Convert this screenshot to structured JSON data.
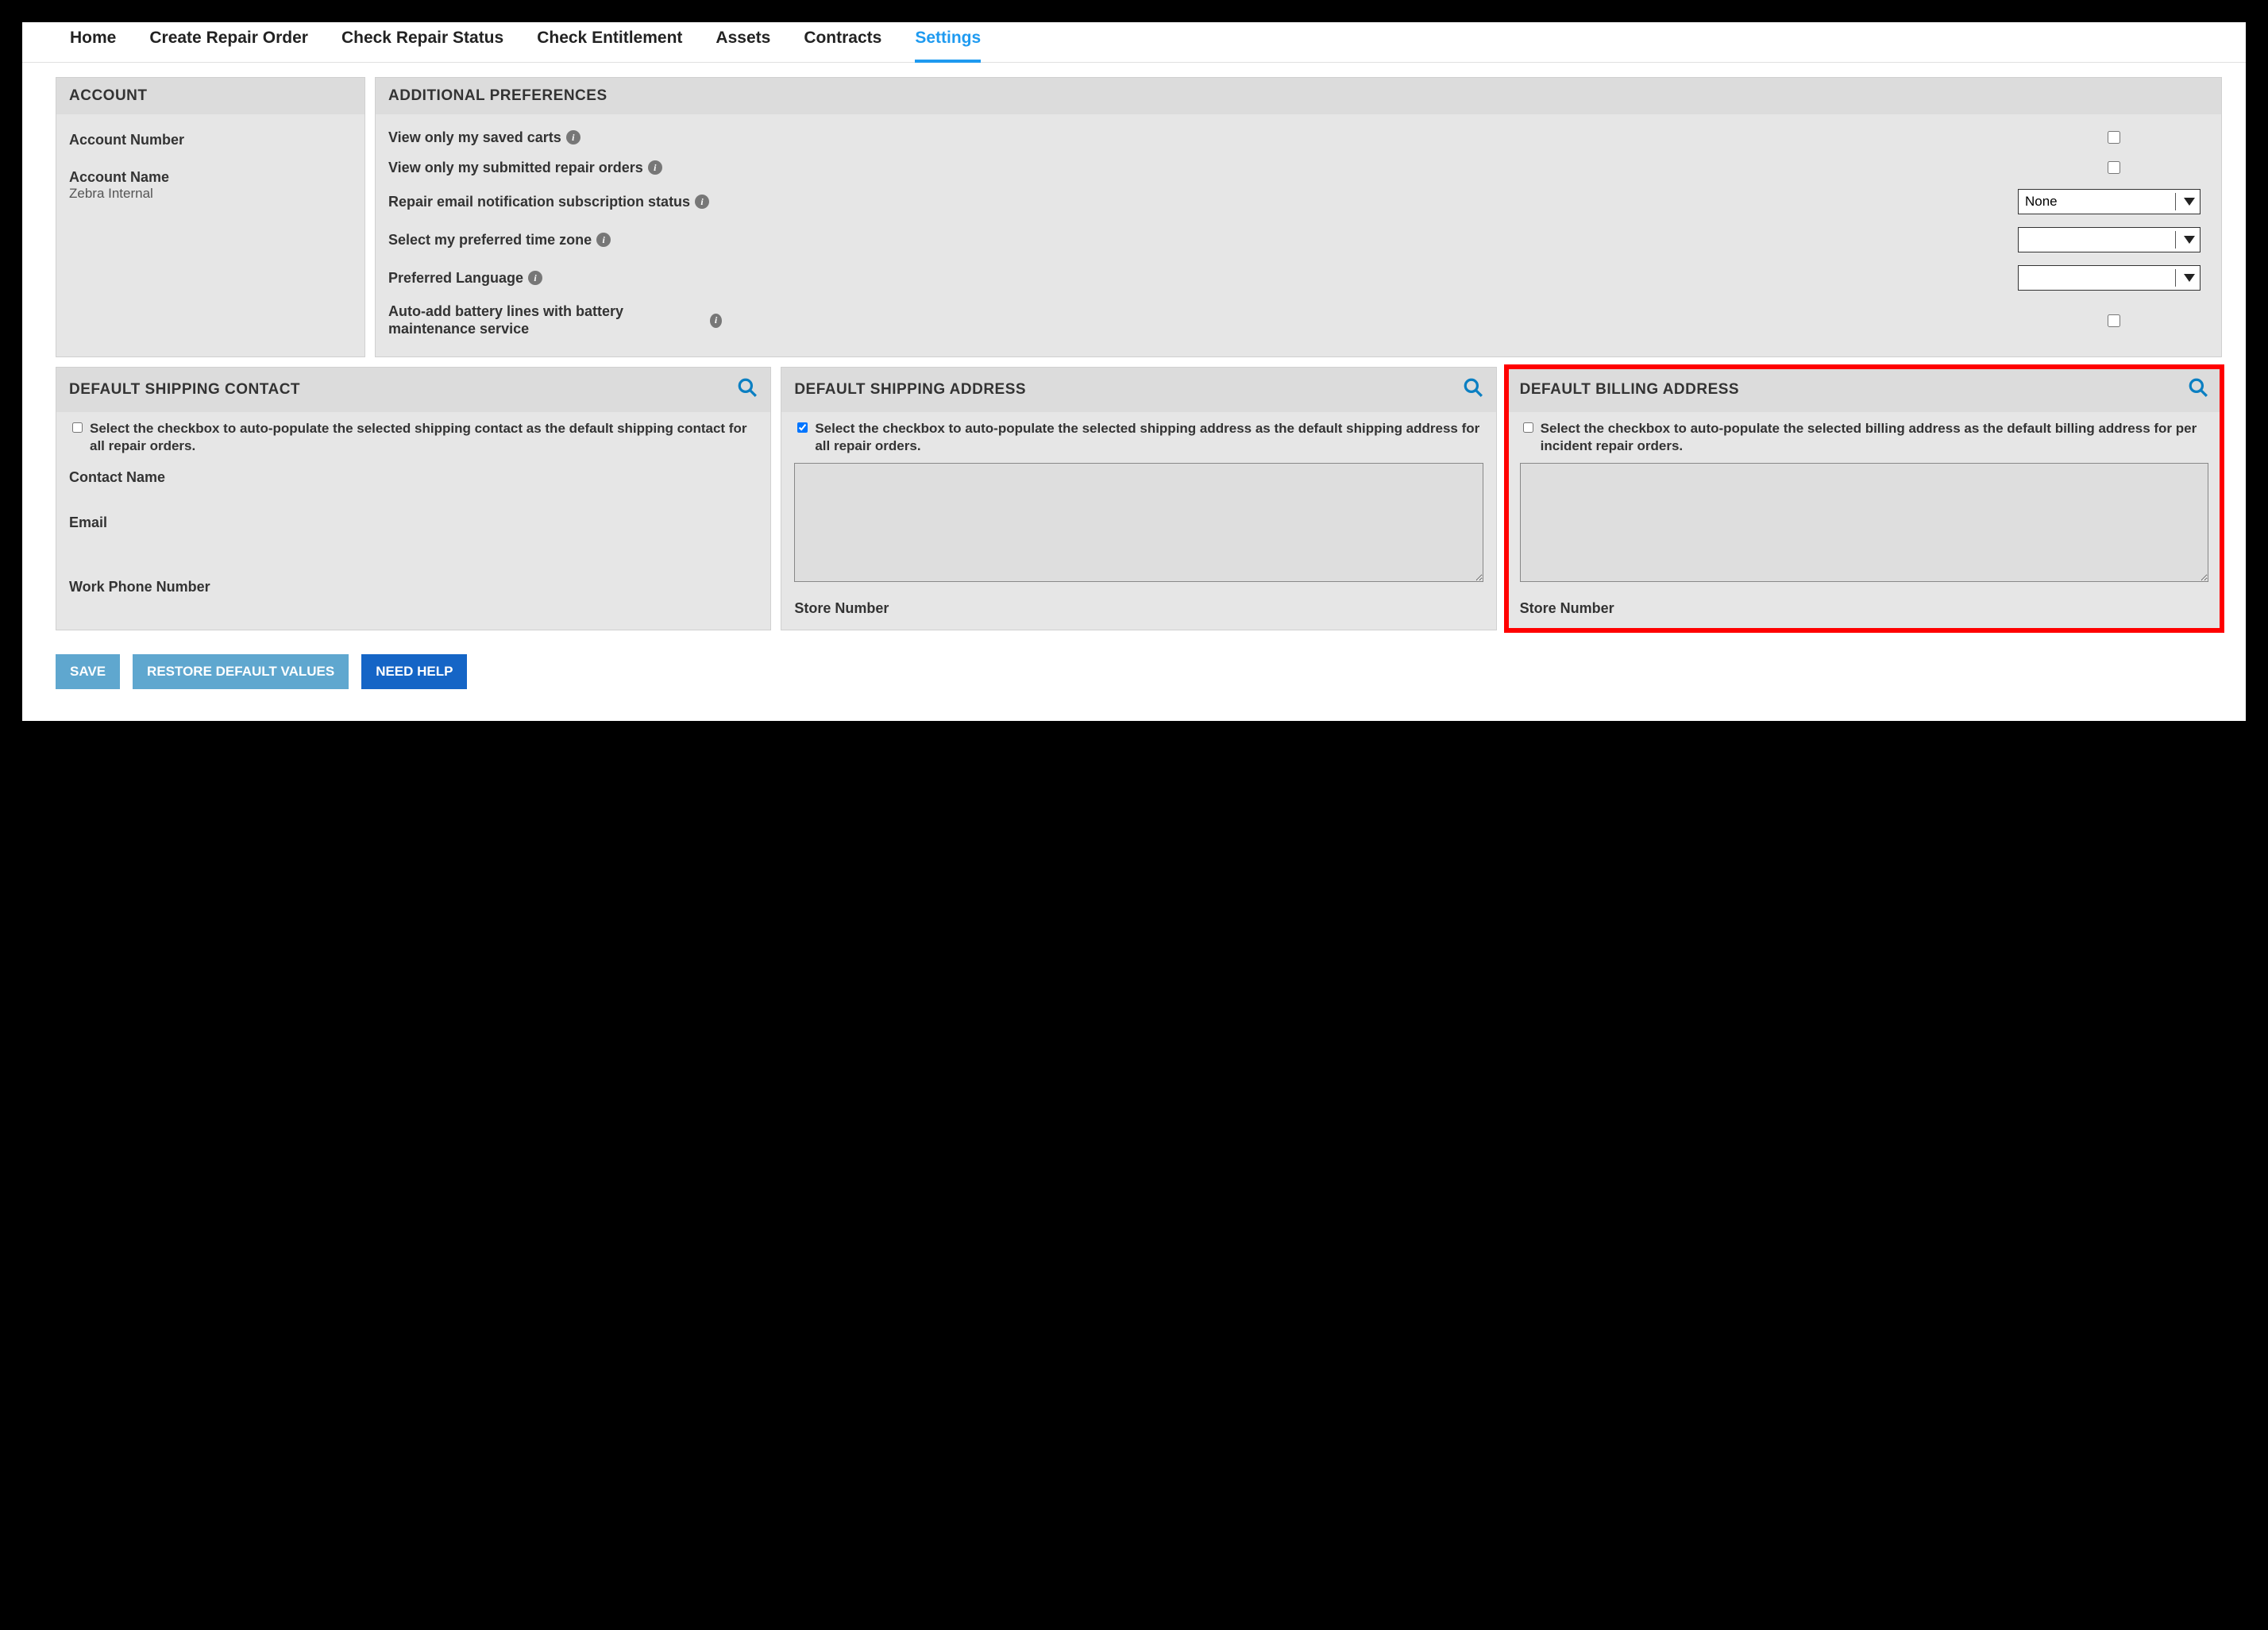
{
  "nav": {
    "items": [
      "Home",
      "Create Repair Order",
      "Check Repair Status",
      "Check Entitlement",
      "Assets",
      "Contracts",
      "Settings"
    ],
    "active": "Settings"
  },
  "account": {
    "title": "ACCOUNT",
    "number_label": "Account Number",
    "number_value": "",
    "name_label": "Account Name",
    "name_value": "Zebra Internal"
  },
  "prefs": {
    "title": "ADDITIONAL PREFERENCES",
    "rows": {
      "saved_carts": {
        "label": "View only my saved carts",
        "checked": false
      },
      "submitted_orders": {
        "label": "View only my submitted repair orders",
        "checked": false
      },
      "email_sub": {
        "label": "Repair email notification subscription status",
        "value": "None"
      },
      "timezone": {
        "label": "Select my preferred time zone",
        "value": ""
      },
      "language": {
        "label": "Preferred Language",
        "value": ""
      },
      "battery": {
        "label": "Auto-add battery lines with battery maintenance service",
        "checked": false
      }
    }
  },
  "shipping_contact": {
    "title": "DEFAULT SHIPPING CONTACT",
    "checkbox_label": "Select the checkbox to auto-populate the selected shipping contact as the default shipping contact for all repair orders.",
    "checked": false,
    "fields": {
      "contact_name": "Contact Name",
      "email": "Email",
      "phone": "Work Phone Number"
    }
  },
  "shipping_address": {
    "title": "DEFAULT SHIPPING ADDRESS",
    "checkbox_label": "Select the checkbox to auto-populate the selected shipping address as the default shipping address for all repair orders.",
    "checked": true,
    "store_label": "Store Number"
  },
  "billing_address": {
    "title": "DEFAULT BILLING ADDRESS",
    "checkbox_label": "Select the checkbox to auto-populate the selected billing address as the default billing address for per incident repair orders.",
    "checked": false,
    "store_label": "Store Number"
  },
  "buttons": {
    "save": "SAVE",
    "restore": "RESTORE DEFAULT VALUES",
    "help": "NEED HELP"
  }
}
